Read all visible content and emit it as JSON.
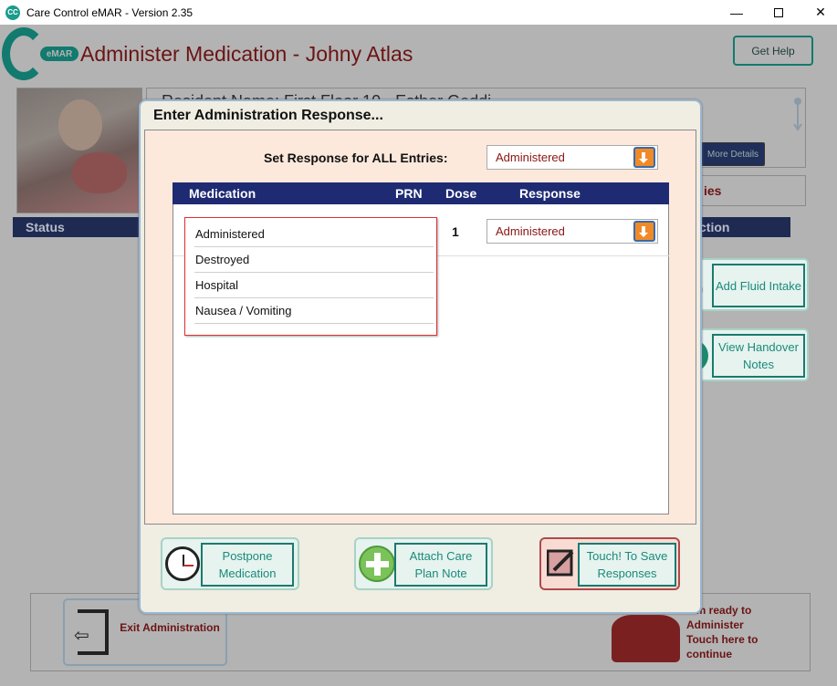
{
  "window": {
    "title": "Care Control eMAR - Version 2.35",
    "app_icon_text": "CC",
    "min_glyph": "—",
    "close_glyph": "✕"
  },
  "header": {
    "logo_badge": "eMAR",
    "title": "Administer Medication - Johny Atlas",
    "help_label": "Get Help"
  },
  "resident": {
    "summary": "Resident Name: First Floor 10 - Esther Geddi...",
    "more_details": "More Details",
    "tab_partial": "ies"
  },
  "background_table": {
    "status_header": "Status",
    "action_header": "ction"
  },
  "background_footer": {
    "exit_label": "Exit Administration",
    "ready_label": "tem ready to Administer Touch here to continue"
  },
  "side_buttons": {
    "fluid_label": "Add Fluid Intake",
    "handover_label": "View Handover Notes"
  },
  "dialog": {
    "title": "Enter Administration Response...",
    "set_all_label": "Set Response for ALL Entries:",
    "set_all_value": "Administered",
    "columns": {
      "medication": "Medication",
      "prn": "PRN",
      "dose": "Dose",
      "response": "Response"
    },
    "rows": [
      {
        "dose": "1",
        "response": "Administered"
      }
    ],
    "dropdown_options": [
      "Administered",
      "Destroyed",
      "Hospital",
      "Nausea / Vomiting"
    ],
    "footer": {
      "postpone_label": "Postpone Medication",
      "attach_label": "Attach Care Plan Note",
      "save_label": "Touch! To Save Responses"
    }
  },
  "colors": {
    "brand_teal": "#127a6e",
    "title_maroon": "#6b1414",
    "grid_header_navy": "#1e2b73",
    "dropdown_border": "#e03030",
    "select_button_orange": "#f08a28"
  }
}
